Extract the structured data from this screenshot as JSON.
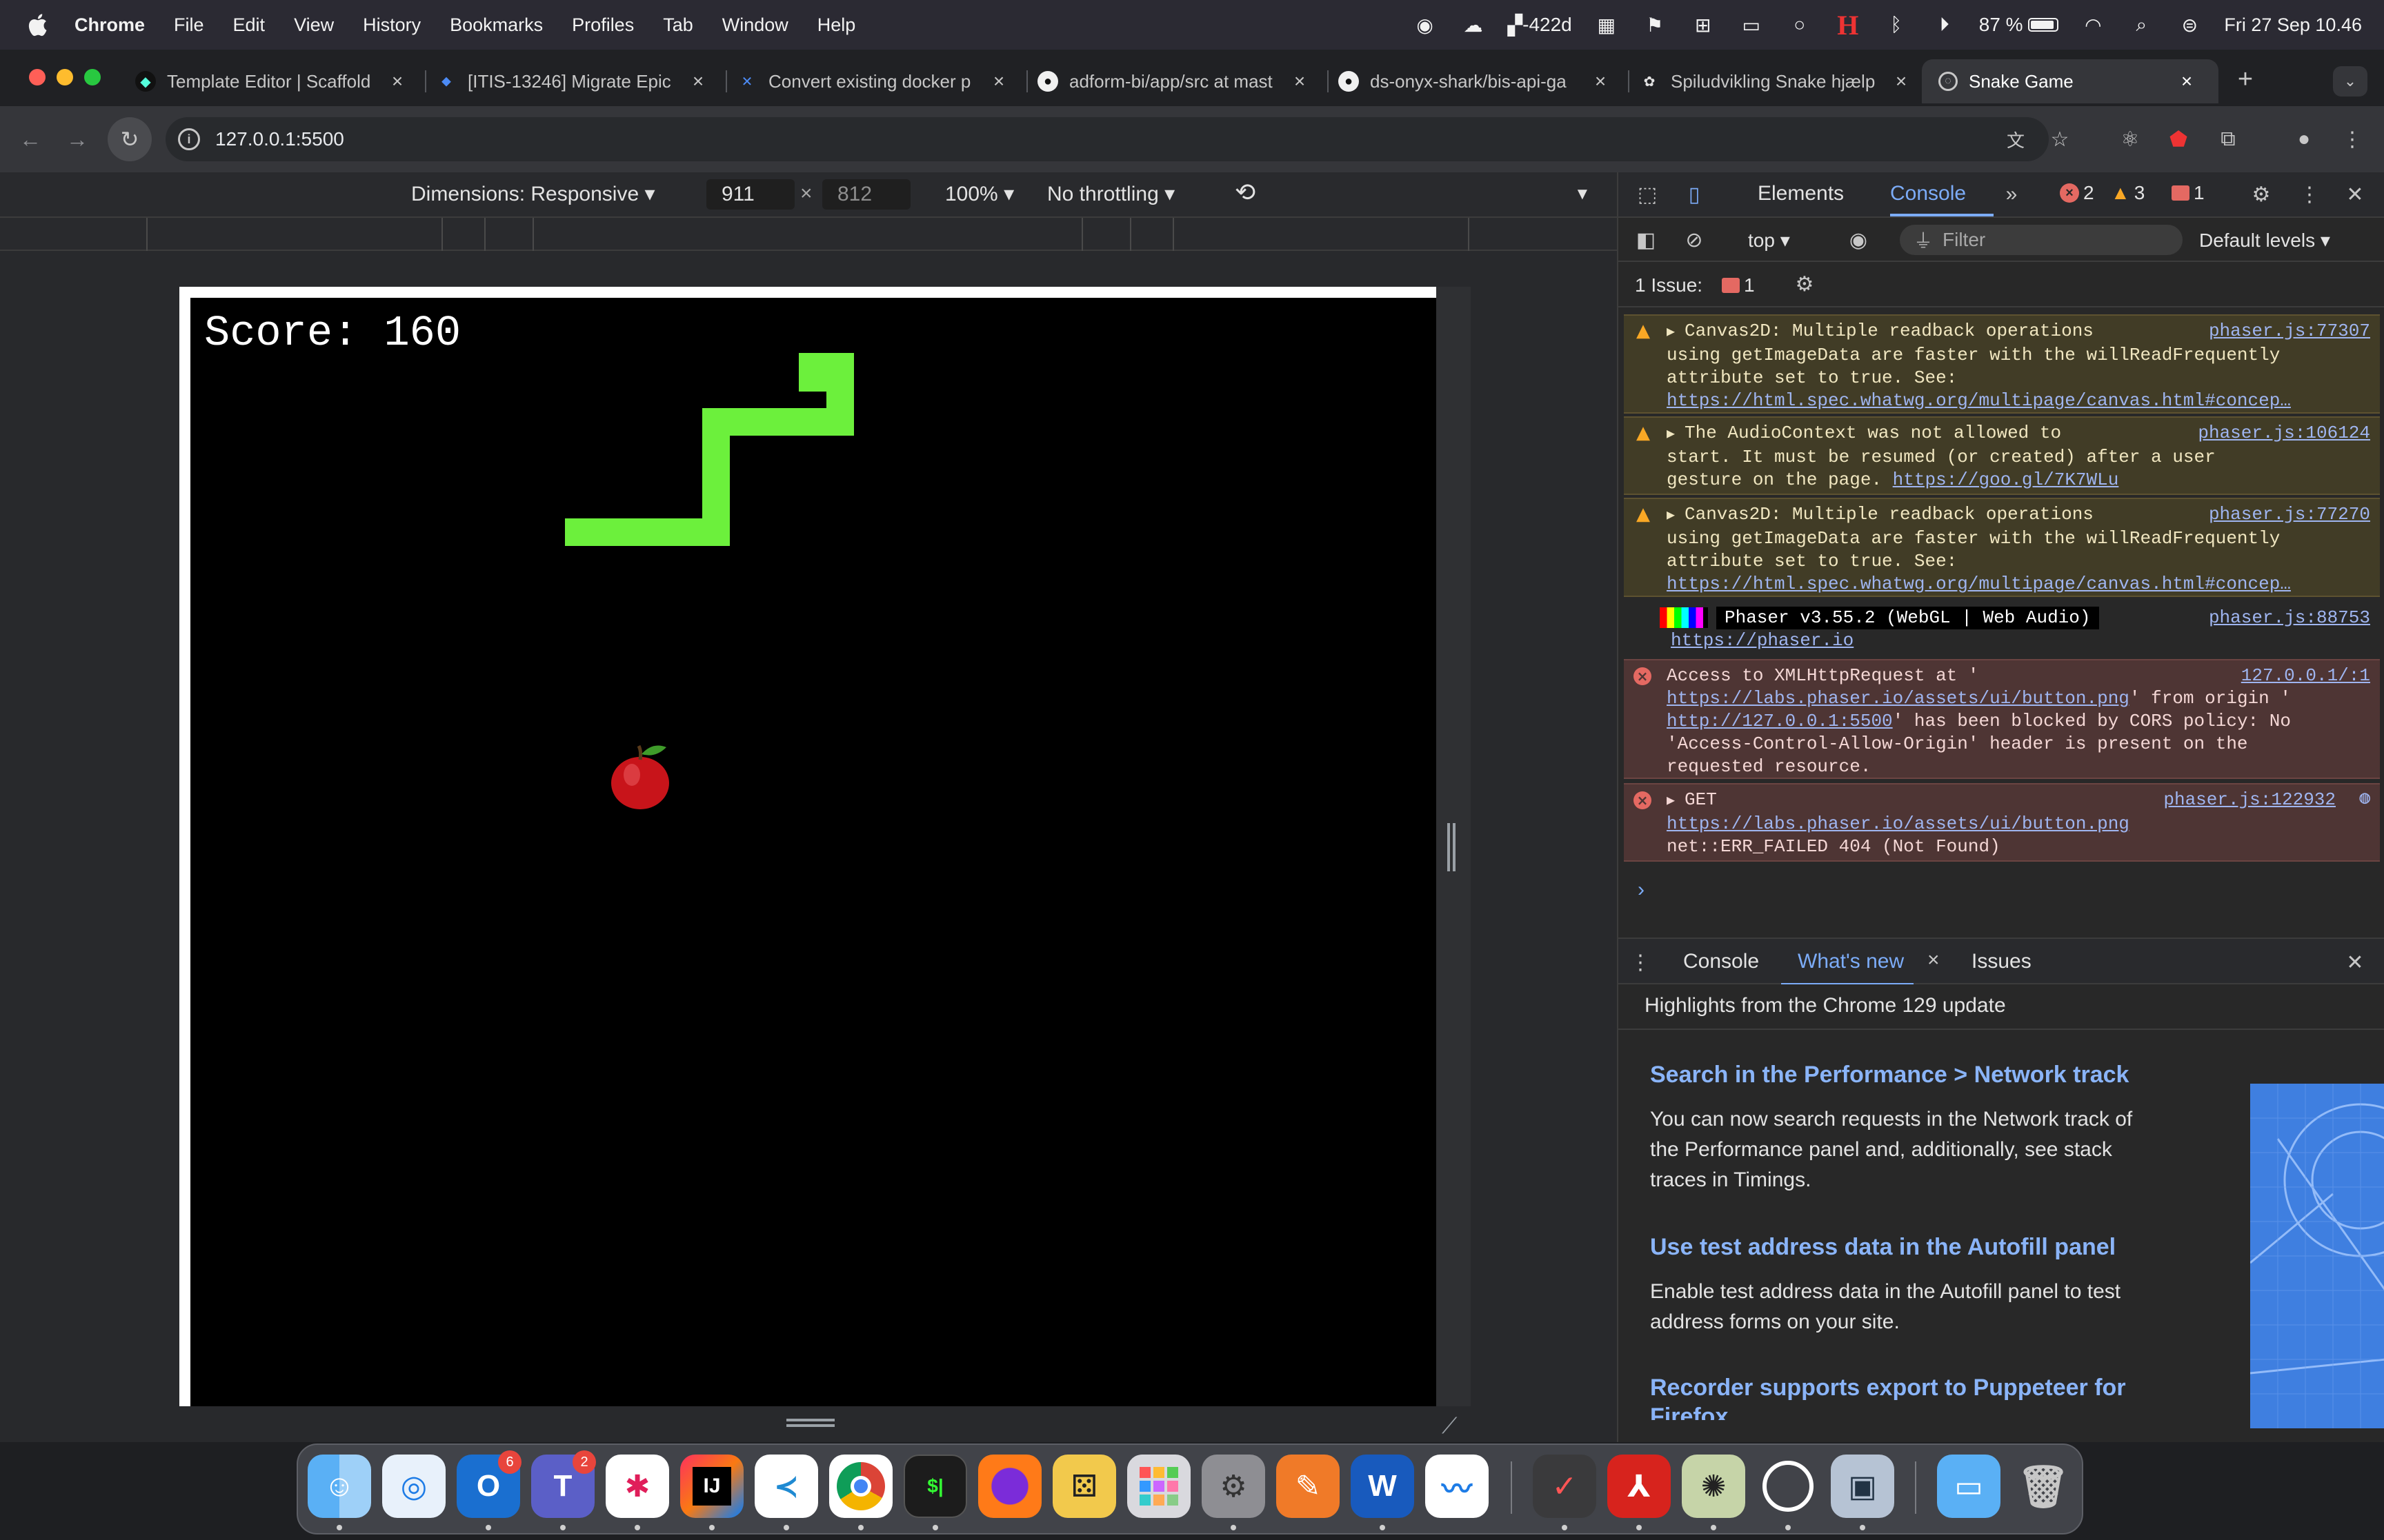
{
  "menubar": {
    "app": "Chrome",
    "items": [
      "File",
      "Edit",
      "View",
      "History",
      "Bookmarks",
      "Profiles",
      "Tab",
      "Window",
      "Help"
    ],
    "status_text": "-422d",
    "battery": "87 %",
    "datetime": "Fri 27 Sep  10.46"
  },
  "tabs": [
    {
      "title": "Template Editor | Scaffold",
      "icon": "scaffold-icon"
    },
    {
      "title": "[ITIS-13246] Migrate Epic",
      "icon": "jira-icon"
    },
    {
      "title": "Convert existing docker p",
      "icon": "confluence-icon"
    },
    {
      "title": "adform-bi/app/src at mast",
      "icon": "github-icon"
    },
    {
      "title": "ds-onyx-shark/bis-api-ga",
      "icon": "github-icon"
    },
    {
      "title": "Spiludvikling Snake hjælp",
      "icon": "openai-icon"
    },
    {
      "title": "Snake Game",
      "icon": "globe-icon",
      "active": true
    }
  ],
  "address": "127.0.0.1:5500",
  "device_toolbar": {
    "dimensions": "Dimensions: Responsive",
    "width": "911",
    "height": "812",
    "zoom": "100%",
    "throttling": "No throttling"
  },
  "game": {
    "score_text": "Score:  160",
    "snake_color": "#6cf03c",
    "food": "apple"
  },
  "devtools": {
    "tabs": [
      "Elements",
      "Console"
    ],
    "active_tab": "Console",
    "errors": "2",
    "warnings": "3",
    "issues": "1",
    "context": "top",
    "filter_placeholder": "Filter",
    "levels": "Default levels",
    "issues_label": "1 Issue:",
    "issues_count": "1",
    "messages": [
      {
        "level": "warning",
        "lines": [
          "Canvas2D: Multiple readback operations",
          "using getImageData are faster with the willReadFrequently",
          "attribute set to true. See:",
          "https://html.spec.whatwg.org/multipage/canvas.html#concep…"
        ],
        "source": "phaser.js:77307"
      },
      {
        "level": "warning",
        "lines": [
          "The AudioContext was not allowed to",
          "start. It must be resumed (or created) after a user",
          "gesture on the page."
        ],
        "link": "https://goo.gl/7K7WLu",
        "source": "phaser.js:106124"
      },
      {
        "level": "warning",
        "lines": [
          "Canvas2D: Multiple readback operations",
          "using getImageData are faster with the willReadFrequently",
          "attribute set to true. See:",
          "https://html.spec.whatwg.org/multipage/canvas.html#concep…"
        ],
        "source": "phaser.js:77270"
      },
      {
        "level": "info",
        "badge": "Phaser v3.55.2 (WebGL | Web Audio)",
        "link": "https://phaser.io",
        "source": "phaser.js:88753"
      },
      {
        "level": "error",
        "prefix": "Access to XMLHttpRequest at '",
        "link1": "https://labs.phaser.io/assets/ui/button.png",
        "mid": "' from origin '",
        "link2": "http://127.0.0.1:5500",
        "rest": [
          "' has been blocked by CORS policy: No",
          "'Access-Control-Allow-Origin' header is present on the",
          "requested resource."
        ],
        "source": "127.0.0.1/:1"
      },
      {
        "level": "error",
        "lines": [
          "GET",
          "https://labs.phaser.io/assets/ui/button.png",
          "net::ERR_FAILED 404 (Not Found)"
        ],
        "source": "phaser.js:122932"
      }
    ],
    "drawer": {
      "tabs": [
        "Console",
        "What's new",
        "Issues"
      ],
      "active": "What's new"
    },
    "whats_new": {
      "header": "Highlights from the Chrome 129 update",
      "items": [
        {
          "title": "Search in the Performance > Network track",
          "text": [
            "You can now search requests in the Network track of",
            "the Performance panel and, additionally, see stack",
            "traces in Timings."
          ]
        },
        {
          "title": "Use test address data in the Autofill panel",
          "text": [
            "Enable test address data in the Autofill panel to test",
            "address forms on your site."
          ]
        },
        {
          "title": "Recorder supports export to Puppeteer for",
          "text": [
            "Firefox"
          ]
        }
      ]
    }
  },
  "dock": {
    "apps": [
      "finder",
      "safari",
      "outlook",
      "teams",
      "slack",
      "intellij",
      "vscode",
      "chrome",
      "terminal",
      "firefox",
      "dice-app",
      "launchpad",
      "system-settings",
      "pages-pen",
      "word",
      "freeform",
      "todo",
      "acrobat",
      "cyberduck",
      "circle-app",
      "preview-app",
      "downloads",
      "trash"
    ],
    "outlook_badge": "6",
    "teams_badge": "2"
  }
}
